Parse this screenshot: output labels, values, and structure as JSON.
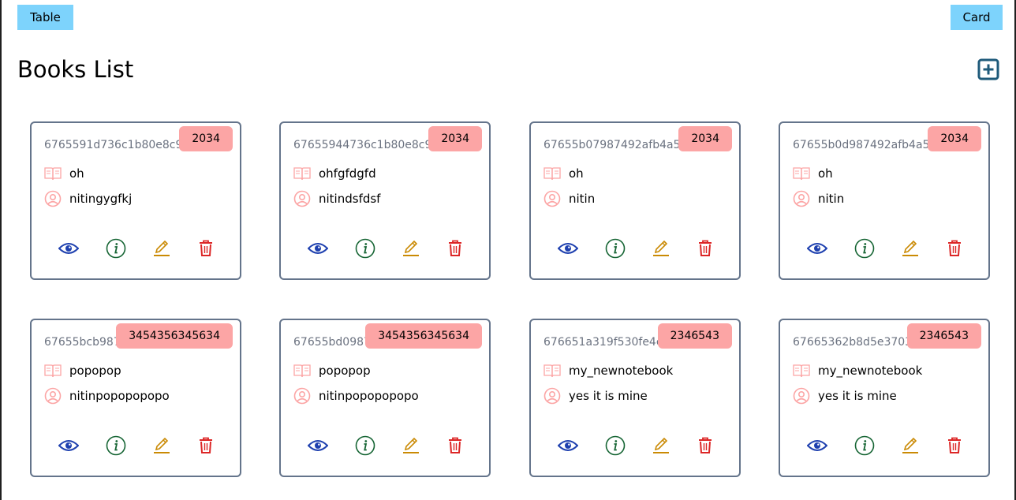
{
  "toolbar": {
    "table_label": "Table",
    "card_label": "Card"
  },
  "page": {
    "title": "Books List",
    "add_icon": "plus-square-icon"
  },
  "colors": {
    "toggle_button": "#7dd3fc",
    "badge": "#fca5a5",
    "card_border": "#64748b",
    "view_icon": "#1e40af",
    "info_icon": "#166534",
    "edit_icon": "#ca8a04",
    "delete_icon": "#dc2626",
    "field_icon": "#fca5a5",
    "add_icon": "#1e5a7a"
  },
  "cards": [
    {
      "id": "6765591d736c1b80e8c9",
      "year": "2034",
      "title": "oh",
      "author": "nitingygfkj"
    },
    {
      "id": "67655944736c1b80e8c9",
      "year": "2034",
      "title": "ohfgfdgfd",
      "author": "nitindsfdsf"
    },
    {
      "id": "67655b07987492afb4a5",
      "year": "2034",
      "title": "oh",
      "author": "nitin"
    },
    {
      "id": "67655b0d987492afb4a5",
      "year": "2034",
      "title": "oh",
      "author": "nitin"
    },
    {
      "id": "67655bcb987492afb4a5",
      "year": "3454356345634",
      "title": "popopop",
      "author": "nitinpopopopopo"
    },
    {
      "id": "67655bd0987492afb4a5",
      "year": "3454356345634",
      "title": "popopop",
      "author": "nitinpopopopopo"
    },
    {
      "id": "676651a319f530fe4c2b",
      "year": "2346543",
      "title": "my_newnotebook",
      "author": "yes it is mine"
    },
    {
      "id": "67665362b8d5e3703b2c",
      "year": "2346543",
      "title": "my_newnotebook",
      "author": "yes it is mine"
    }
  ],
  "card_icons": {
    "title": "book-open-icon",
    "author": "user-circle-icon",
    "view": "eye-icon",
    "info": "info-circle-icon",
    "edit": "pencil-icon",
    "delete": "trash-icon"
  }
}
